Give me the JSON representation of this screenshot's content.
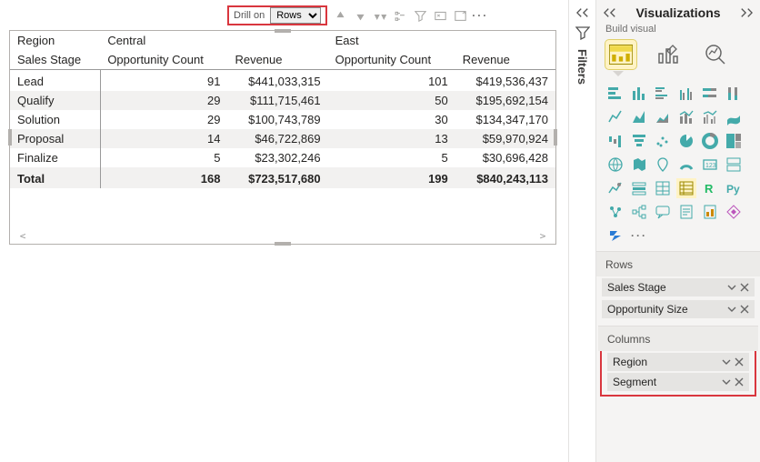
{
  "toolbar": {
    "drill_label": "Drill on",
    "drill_value": "Rows"
  },
  "matrix": {
    "corner1": "Region",
    "corner2": "Sales Stage",
    "regions": [
      "Central",
      "East"
    ],
    "sub_cols": [
      "Opportunity Count",
      "Revenue",
      "Opportunity Count",
      "Revenue"
    ],
    "rows": [
      {
        "stage": "Lead",
        "c1": 91,
        "r1": "$441,033,315",
        "c2": 101,
        "r2": "$419,536,437"
      },
      {
        "stage": "Qualify",
        "c1": 29,
        "r1": "$111,715,461",
        "c2": 50,
        "r2": "$195,692,154"
      },
      {
        "stage": "Solution",
        "c1": 29,
        "r1": "$100,743,789",
        "c2": 30,
        "r2": "$134,347,170"
      },
      {
        "stage": "Proposal",
        "c1": 14,
        "r1": "$46,722,869",
        "c2": 13,
        "r2": "$59,970,924"
      },
      {
        "stage": "Finalize",
        "c1": 5,
        "r1": "$23,302,246",
        "c2": 5,
        "r2": "$30,696,428"
      }
    ],
    "total_label": "Total",
    "total": {
      "c1": 168,
      "r1": "$723,517,680",
      "c2": 199,
      "r2": "$840,243,113"
    }
  },
  "filters": {
    "label": "Filters"
  },
  "viz": {
    "title": "Visualizations",
    "build": "Build visual",
    "rows_head": "Rows",
    "rows_fields": [
      "Sales Stage",
      "Opportunity Size"
    ],
    "cols_head": "Columns",
    "cols_fields": [
      "Region",
      "Segment"
    ],
    "more": "···"
  },
  "chart_data": {
    "type": "table",
    "title": "Matrix visual: Sales Stage × Region",
    "columns": [
      "Region",
      "Sales Stage",
      "Central Opportunity Count",
      "Central Revenue",
      "East Opportunity Count",
      "East Revenue"
    ],
    "series": [
      {
        "name": "Central Opportunity Count",
        "categories": [
          "Lead",
          "Qualify",
          "Solution",
          "Proposal",
          "Finalize"
        ],
        "values": [
          91,
          29,
          29,
          14,
          5
        ]
      },
      {
        "name": "Central Revenue",
        "categories": [
          "Lead",
          "Qualify",
          "Solution",
          "Proposal",
          "Finalize"
        ],
        "values": [
          441033315,
          111715461,
          100743789,
          46722869,
          23302246
        ]
      },
      {
        "name": "East Opportunity Count",
        "categories": [
          "Lead",
          "Qualify",
          "Solution",
          "Proposal",
          "Finalize"
        ],
        "values": [
          101,
          50,
          30,
          13,
          5
        ]
      },
      {
        "name": "East Revenue",
        "categories": [
          "Lead",
          "Qualify",
          "Solution",
          "Proposal",
          "Finalize"
        ],
        "values": [
          419536437,
          195692154,
          134347170,
          59970924,
          30696428
        ]
      }
    ],
    "totals": {
      "Central Opportunity Count": 168,
      "Central Revenue": 723517680,
      "East Opportunity Count": 199,
      "East Revenue": 840243113
    }
  }
}
